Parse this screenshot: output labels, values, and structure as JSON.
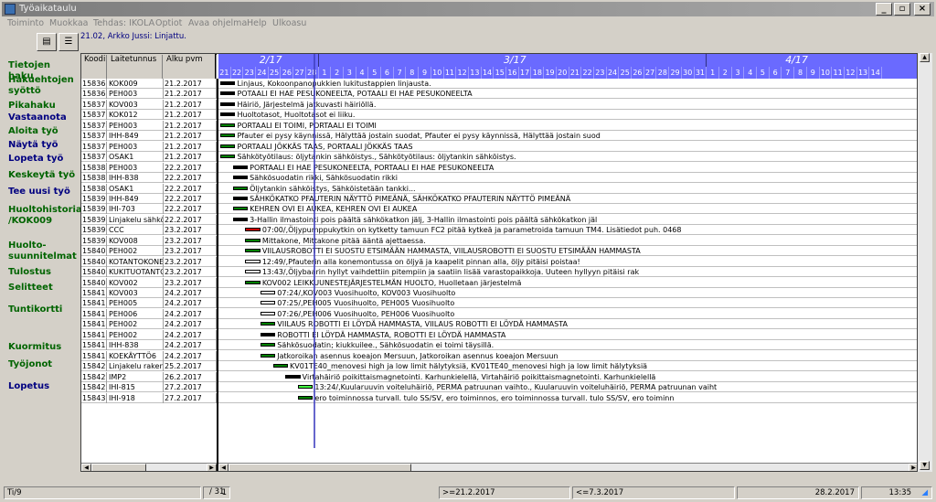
{
  "window": {
    "title": "Työaikataulu"
  },
  "menu": [
    "Toiminto",
    "Muokkaa",
    "Tehdas: IKOLA",
    "Optiot",
    "Avaa ohjelma",
    "Help",
    "Ulkoasu"
  ],
  "top_message": "21.02, Arkko Jussi: Linjattu.",
  "sidebar": [
    {
      "label": "Tietojen haku",
      "color": "green"
    },
    {
      "label": "Hakuehtojen syöttö",
      "color": "green"
    },
    {
      "label": "Pikahaku",
      "color": "green"
    },
    {
      "label": "Vastaanota",
      "color": "blue"
    },
    {
      "label": "Aloita työ",
      "color": "green"
    },
    {
      "label": "Näytä työ",
      "color": "blue"
    },
    {
      "label": "Lopeta työ",
      "color": "blue"
    },
    {
      "label": "Keskeytä työ",
      "color": "green"
    },
    {
      "label": "Tee uusi työ",
      "color": "blue"
    },
    {
      "label": "Huoltohistoria /KOK009",
      "color": "green"
    },
    {
      "label": "Huolto-suunnitelmat",
      "color": "green"
    },
    {
      "label": "Tulostus",
      "color": "green"
    },
    {
      "label": "Selitteet",
      "color": "green"
    },
    {
      "label": "Tuntikortti",
      "color": "green"
    },
    {
      "label": "Kuormitus",
      "color": "green"
    },
    {
      "label": "Työjonot",
      "color": "green"
    },
    {
      "label": "Lopetus",
      "color": "blue"
    }
  ],
  "columns": {
    "koodi": "Koodi",
    "laitetunnus": "Laitetunnus",
    "alku": "Alku pvm"
  },
  "months": [
    "2/17",
    "3/17",
    "4/17"
  ],
  "days": [
    "21",
    "22",
    "23",
    "24",
    "25",
    "26",
    "27",
    "28",
    "1",
    "2",
    "3",
    "4",
    "5",
    "6",
    "7",
    "8",
    "9",
    "10",
    "11",
    "12",
    "13",
    "14",
    "15",
    "16",
    "17",
    "18",
    "19",
    "20",
    "21",
    "22",
    "23",
    "24",
    "25",
    "26",
    "27",
    "28",
    "29",
    "30",
    "31",
    "1",
    "2",
    "3",
    "4",
    "5",
    "6",
    "7",
    "8",
    "9",
    "10",
    "11",
    "12",
    "13",
    "14"
  ],
  "rows": [
    {
      "koodi": "158362",
      "laite": "KOK009",
      "alku": "21.2.2017",
      "start": 0,
      "len": 1.2,
      "color": "#000000",
      "desc": "Linjaus, Kokoonpanopukkien lukitustappien linjausta."
    },
    {
      "koodi": "158367",
      "laite": "PEH003",
      "alku": "21.2.2017",
      "start": 0,
      "len": 1.2,
      "color": "#000000",
      "desc": "POTAALI EI HAE PESUKONEELTA, POTAALI EI HAE PESUKONEELTA"
    },
    {
      "koodi": "158372",
      "laite": "KOV003",
      "alku": "21.2.2017",
      "start": 0,
      "len": 1.2,
      "color": "#000000",
      "desc": "Häiriö, Järjestelmä jatkuvasti häiriöllä."
    },
    {
      "koodi": "158373",
      "laite": "KOK012",
      "alku": "21.2.2017",
      "start": 0,
      "len": 1.2,
      "color": "#000000",
      "desc": "Huoltotasot, Huoltotasot ei liiku."
    },
    {
      "koodi": "158374",
      "laite": "PEH003",
      "alku": "21.2.2017",
      "start": 0,
      "len": 1.2,
      "color": "#008000",
      "desc": "PORTAALI EI TOIMI, PORTAALI EI TOIMI"
    },
    {
      "koodi": "158375",
      "laite": "IHH-849",
      "alku": "21.2.2017",
      "start": 0,
      "len": 1.2,
      "color": "#008000",
      "desc": "Pfauter ei pysy käynnissä, Hälyttää jostain suodat, Pfauter ei pysy käynnissä, Hälyttää jostain suod"
    },
    {
      "koodi": "158377",
      "laite": "PEH003",
      "alku": "21.2.2017",
      "start": 0,
      "len": 1.2,
      "color": "#008000",
      "desc": "PORTAALI JÖKKÄS TAAS, PORTAALI JÖKKÄS TAAS"
    },
    {
      "koodi": "158378",
      "laite": "OSAK1",
      "alku": "21.2.2017",
      "start": 0,
      "len": 1.2,
      "color": "#008000",
      "desc": "Sähkötyötilaus: öljytankin sähköistys., Sähkötyötilaus: öljytankin sähköistys."
    },
    {
      "koodi": "158380",
      "laite": "PEH003",
      "alku": "22.2.2017",
      "start": 1,
      "len": 1.2,
      "color": "#000000",
      "desc": "PORTAALI EI HAE PESUKONEELTA, PORTAALI EI HAE PESUKONEELTA"
    },
    {
      "koodi": "158383",
      "laite": "IHH-838",
      "alku": "22.2.2017",
      "start": 1,
      "len": 1.2,
      "color": "#000000",
      "desc": "Sähkösuodatin rikki, Sähkösuodatin rikki"
    },
    {
      "koodi": "158388",
      "laite": "OSAK1",
      "alku": "22.2.2017",
      "start": 1,
      "len": 1.2,
      "color": "#008000",
      "desc": "Öljytankin sähköistys, Sähköistetään tankki..."
    },
    {
      "koodi": "158391",
      "laite": "IHH-849",
      "alku": "22.2.2017",
      "start": 1,
      "len": 1.2,
      "color": "#000000",
      "desc": "SÄHKÖKATKO PFAUTERIN NÄYTTÖ PIMEÄNÄ, SÄHKÖKATKO PFAUTERIN NÄYTTÖ PIMEÄNÄ"
    },
    {
      "koodi": "158392",
      "laite": "IHI-703",
      "alku": "22.2.2017",
      "start": 1,
      "len": 1.2,
      "color": "#008000",
      "desc": "KEHREN OVI EI AUKEA, KEHREN OVI EI AUKEA"
    },
    {
      "koodi": "158393",
      "laite": "Linjakelu sähköläi",
      "alku": "22.2.2017",
      "start": 1,
      "len": 1.2,
      "color": "#000000",
      "desc": "3-Hallin ilmastointi pois päältä sähkökatkon jälj, 3-Hallin ilmastointi pois päältä sähkökatkon jäl"
    },
    {
      "koodi": "158390",
      "laite": "CCC",
      "alku": "23.2.2017",
      "start": 2,
      "len": 1.2,
      "color": "#cc0000",
      "desc": "07:00/,Öljypumppukytkin on kytketty tamuun FC2 pitää kytkeä ja parametroida tamuun TM4. Lisätiedot puh. 0468"
    },
    {
      "koodi": "158397",
      "laite": "KOV008",
      "alku": "23.2.2017",
      "start": 2,
      "len": 1.2,
      "color": "#008000",
      "desc": "Mittakone, Mittakone pitää ääntä ajettaessa."
    },
    {
      "koodi": "158400",
      "laite": "PEH002",
      "alku": "23.2.2017",
      "start": 2,
      "len": 1.2,
      "color": "#008000",
      "desc": "VIILAUSROBOTTI EI SUOSTU ETSIMÄÄN HAMMASTA, VIILAUSROBOTTI EI SUOSTU ETSIMÄÄN HAMMASTA"
    },
    {
      "koodi": "158404",
      "laite": "KOTANTOKONEE",
      "alku": "23.2.2017",
      "start": 2,
      "len": 1.2,
      "color": "#ffffff",
      "desc": "12:49/,Pfauterin alla konemontussa on öljyä ja kaapelit pinnan alla, öljy pitäisi poistaa!"
    },
    {
      "koodi": "158405",
      "laite": "KUKITUOTANTO",
      "alku": "23.2.2017",
      "start": 2,
      "len": 1.2,
      "color": "#ffffff",
      "desc": "13:43/,Öljybaarin hyllyt vaihdettiin pitempiin ja saatiin lisää varastopaikkoja. Uuteen hyllyyn pitäisi rak"
    },
    {
      "koodi": "158408",
      "laite": "KOV002",
      "alku": "23.2.2017",
      "start": 2,
      "len": 1.2,
      "color": "#008000",
      "desc": "KOV002 LEIKKUUNESTEJÄRJESTELMÄN HUOLTO, Huolletaan järjestelmä"
    },
    {
      "koodi": "158411",
      "laite": "KOV003",
      "alku": "24.2.2017",
      "start": 3.2,
      "len": 1.2,
      "color": "#ffffff",
      "desc": "07:24/,KOV003 Vuosihuolto, KOV003 Vuosihuolto"
    },
    {
      "koodi": "158412",
      "laite": "PEH005",
      "alku": "24.2.2017",
      "start": 3.2,
      "len": 1.2,
      "color": "#ffffff",
      "desc": "07:25/,PEH005 Vuosihuolto, PEH005 Vuosihuolto"
    },
    {
      "koodi": "158413",
      "laite": "PEH006",
      "alku": "24.2.2017",
      "start": 3.2,
      "len": 1.2,
      "color": "#ffffff",
      "desc": "07:26/,PEH006 Vuosihuolto, PEH006 Vuosihuolto"
    },
    {
      "koodi": "158414",
      "laite": "PEH002",
      "alku": "24.2.2017",
      "start": 3.2,
      "len": 1.2,
      "color": "#008000",
      "desc": "VIILAUS ROBOTTI EI LÖYDÄ HAMMASTA, VIILAUS ROBOTTI EI LÖYDÄ HAMMASTA"
    },
    {
      "koodi": "158416",
      "laite": "PEH002",
      "alku": "24.2.2017",
      "start": 3.2,
      "len": 1.2,
      "color": "#000000",
      "desc": "ROBOTTI EI LÖYDÄ HAMMASTA, ROBOTTI EI LÖYDÄ HAMMASTA"
    },
    {
      "koodi": "158417",
      "laite": "IHH-838",
      "alku": "24.2.2017",
      "start": 3.2,
      "len": 1.2,
      "color": "#008000",
      "desc": "Sähkösuodatin; kiukkuilee., Sähkösuodatin ei toimi täysillä."
    },
    {
      "koodi": "158419",
      "laite": "KOEKÄYTTÖ6",
      "alku": "24.2.2017",
      "start": 3.2,
      "len": 1.2,
      "color": "#008000",
      "desc": "Jatkoroikan asennus koeajon Mersuun, Jatkoroikan asennus koeajon Mersuun"
    },
    {
      "koodi": "158426",
      "laite": "Linjakelu rakenn",
      "alku": "25.2.2017",
      "start": 4.2,
      "len": 1.2,
      "color": "#008000",
      "desc": "KV01TE40_menovesi high ja low limit hälytyksiä, KV01TE40_menovesi high ja low limit hälytyksiä"
    },
    {
      "koodi": "158427",
      "laite": "IMP2",
      "alku": "26.2.2017",
      "start": 5.2,
      "len": 1.2,
      "color": "#000000",
      "desc": "Virtahäiriö poikittaismagnetointi. Karhunkielellä, Virtahäiriö poikittaismagnetointi. Karhunkielellä"
    },
    {
      "koodi": "158429",
      "laite": "IHI-815",
      "alku": "27.2.2017",
      "start": 6.2,
      "len": 1.2,
      "color": "#40ff40",
      "desc": "13:24/,Kuularuuvin voiteluhäiriö, PERMA patruunan vaihto., Kuularuuvin voiteluhäiriö, PERMA patruunan vaiht"
    },
    {
      "koodi": "158436",
      "laite": "IHI-918",
      "alku": "27.2.2017",
      "start": 6.2,
      "len": 1.2,
      "color": "#008000",
      "desc": "ero toiminnossa turvall. tulo SS/SV, ero toiminnos, ero toiminnossa turvall. tulo SS/SV, ero toiminn"
    }
  ],
  "status": {
    "left": "Ti/9",
    "page": "1",
    "page_total": "/ 31",
    "from": ">=21.2.2017",
    "to": "<=7.3.2017",
    "date": "28.2.2017",
    "time": "13:35"
  }
}
